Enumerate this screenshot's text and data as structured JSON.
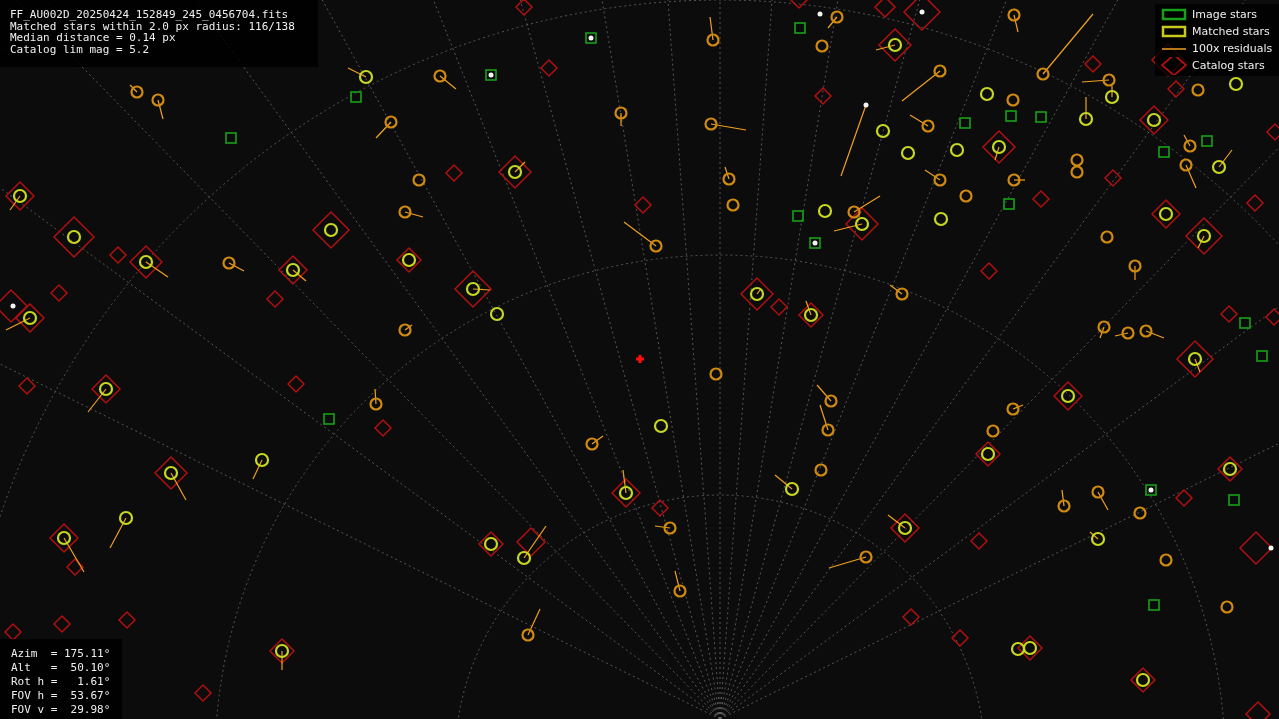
{
  "info": {
    "lines": [
      "FF_AU002D_20250424_152849_245_0456704.fits",
      "Matched stars within 2.0 px radius: 116/138",
      "Median distance = 0.14 px",
      "Catalog lim mag = 5.2"
    ]
  },
  "legend": [
    {
      "kind": "image",
      "label": "Image stars"
    },
    {
      "kind": "matched",
      "label": "Matched stars"
    },
    {
      "kind": "residual",
      "label": "100x residuals"
    },
    {
      "kind": "catalog",
      "label": "Catalog stars"
    }
  ],
  "pointing": {
    "lines": [
      "Azim  = 175.11°",
      "Alt   =  50.10°",
      "Rot h =   1.61°",
      "FOV h =  53.67°",
      "FOV v =  29.98°"
    ]
  }
}
